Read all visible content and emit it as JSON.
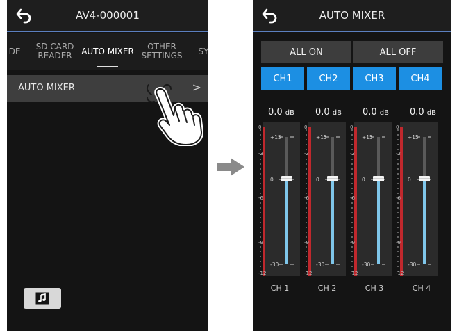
{
  "left_screen": {
    "title": "AV4-000001",
    "tabs": [
      {
        "label": "DE"
      },
      {
        "label": "SD CARD\nREADER"
      },
      {
        "label": "AUTO MIXER",
        "active": true
      },
      {
        "label": "OTHER\nSETTINGS"
      },
      {
        "label": "SY"
      }
    ],
    "menu_item": {
      "label": "AUTO MIXER",
      "chevron": ">"
    },
    "music_button_icon": "music-note-icon"
  },
  "right_screen": {
    "title": "AUTO MIXER",
    "all_on_label": "ALL ON",
    "all_off_label": "ALL OFF",
    "channel_buttons": [
      "CH1",
      "CH2",
      "CH3",
      "CH4"
    ],
    "db_unit": "dB",
    "meter_scale": [
      "0",
      "-3",
      "-6",
      "-9",
      "-12"
    ],
    "fader_scale": [
      "+15",
      "0",
      "-30"
    ],
    "channels": [
      {
        "level": "0.0",
        "name": "CH 1"
      },
      {
        "level": "0.0",
        "name": "CH 2"
      },
      {
        "level": "0.0",
        "name": "CH 3"
      },
      {
        "level": "0.0",
        "name": "CH 4"
      }
    ]
  },
  "colors": {
    "accent_blue": "#1c8fe3",
    "title_underline": "#5b7fbf",
    "meter_red": "#c0282d",
    "fader_track": "#7fc6ea"
  }
}
